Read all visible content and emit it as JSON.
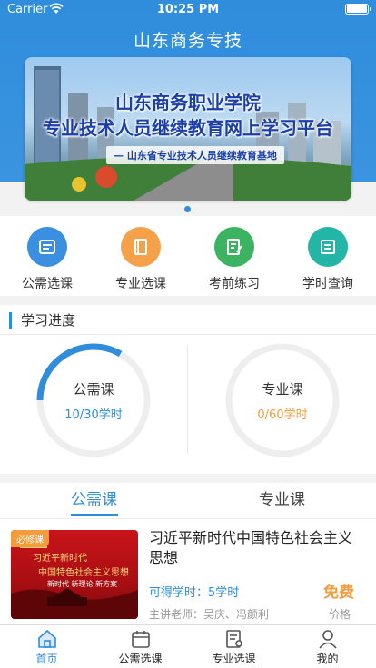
{
  "status": {
    "carrier": "Carrier",
    "time": "10:25 PM"
  },
  "app": {
    "title": "山东商务专技"
  },
  "banner": {
    "title": "山东商务职业学院",
    "subtitle": "专业技术人员继续教育网上学习平台",
    "tag": "— 山东省专业技术人员继续教育基地"
  },
  "quick_actions": [
    {
      "label": "公需选课",
      "icon": "list-icon",
      "color": "#3a8fe0"
    },
    {
      "label": "专业选课",
      "icon": "book-icon",
      "color": "#f5a14a"
    },
    {
      "label": "考前练习",
      "icon": "exam-icon",
      "color": "#3cb361"
    },
    {
      "label": "学时查询",
      "icon": "query-icon",
      "color": "#23b6a7"
    }
  ],
  "progress": {
    "title": "学习进度",
    "public": {
      "name": "公需课",
      "value": "10/30学时",
      "earned": 10,
      "total": 30,
      "color": "#2f8ddc"
    },
    "professional": {
      "name": "专业课",
      "value": "0/60学时",
      "earned": 0,
      "total": 60,
      "color": "#f39c3e"
    }
  },
  "tabs": {
    "public": "公需课",
    "professional": "专业课"
  },
  "course": {
    "badge": "必修课",
    "title": "习近平新时代中国特色社会主义思想",
    "hours": "可得学时：5学时",
    "price": "免费",
    "teacher": "主讲老师：吴庆、冯颜利",
    "price_label": "价格",
    "thumb_line1": "习近平新时代",
    "thumb_line2": "中国特色社会主义思想",
    "thumb_line3": "新时代 新理论 新方案"
  },
  "tabbar": [
    {
      "label": "首页",
      "icon": "home-icon"
    },
    {
      "label": "公需选课",
      "icon": "calendar-icon"
    },
    {
      "label": "专业选课",
      "icon": "document-icon"
    },
    {
      "label": "我的",
      "icon": "user-icon"
    }
  ]
}
